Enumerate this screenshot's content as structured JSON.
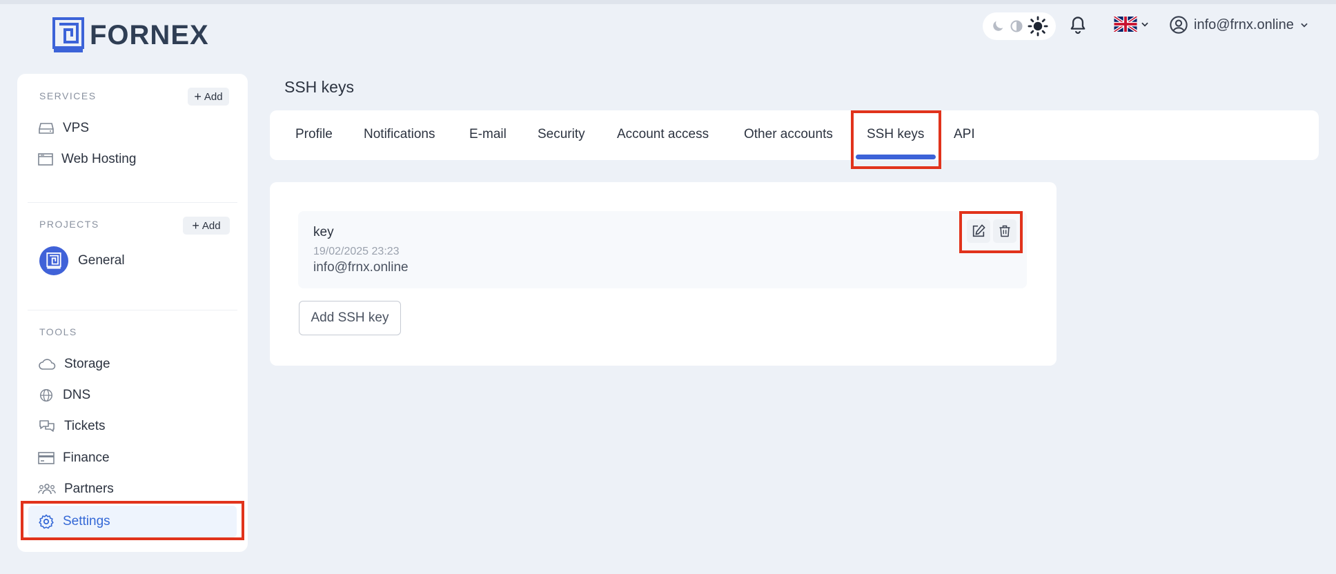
{
  "brand": {
    "name": "FORNEX"
  },
  "header": {
    "user_email": "info@frnx.online"
  },
  "sidebar": {
    "services": {
      "heading": "SERVICES",
      "add_label": "Add",
      "items": [
        {
          "label": "VPS",
          "icon": "server-icon"
        },
        {
          "label": "Web Hosting",
          "icon": "browser-window-icon"
        }
      ]
    },
    "projects": {
      "heading": "PROJECTS",
      "add_label": "Add",
      "items": [
        {
          "label": "General",
          "icon": "project-logo-icon"
        }
      ]
    },
    "tools": {
      "heading": "TOOLS",
      "items": [
        {
          "label": "Storage",
          "icon": "cloud-icon"
        },
        {
          "label": "DNS",
          "icon": "globe-icon"
        },
        {
          "label": "Tickets",
          "icon": "chat-bubbles-icon"
        },
        {
          "label": "Finance",
          "icon": "credit-card-icon"
        },
        {
          "label": "Partners",
          "icon": "users-icon"
        },
        {
          "label": "Settings",
          "icon": "gear-icon",
          "active": true
        }
      ]
    }
  },
  "main": {
    "page_title": "SSH keys",
    "tabs": [
      {
        "label": "Profile"
      },
      {
        "label": "Notifications"
      },
      {
        "label": "E-mail"
      },
      {
        "label": "Security"
      },
      {
        "label": "Account access"
      },
      {
        "label": "Other accounts"
      },
      {
        "label": "SSH keys",
        "active": true
      },
      {
        "label": "API"
      }
    ],
    "ssh_keys": [
      {
        "name": "key",
        "date": "19/02/2025 23:23",
        "email": "info@frnx.online"
      }
    ],
    "add_button_label": "Add SSH key"
  },
  "colors": {
    "accent": "#3c63d8",
    "active_text": "#3468d6",
    "highlight": "#e1331c",
    "background": "#edf1f7"
  }
}
